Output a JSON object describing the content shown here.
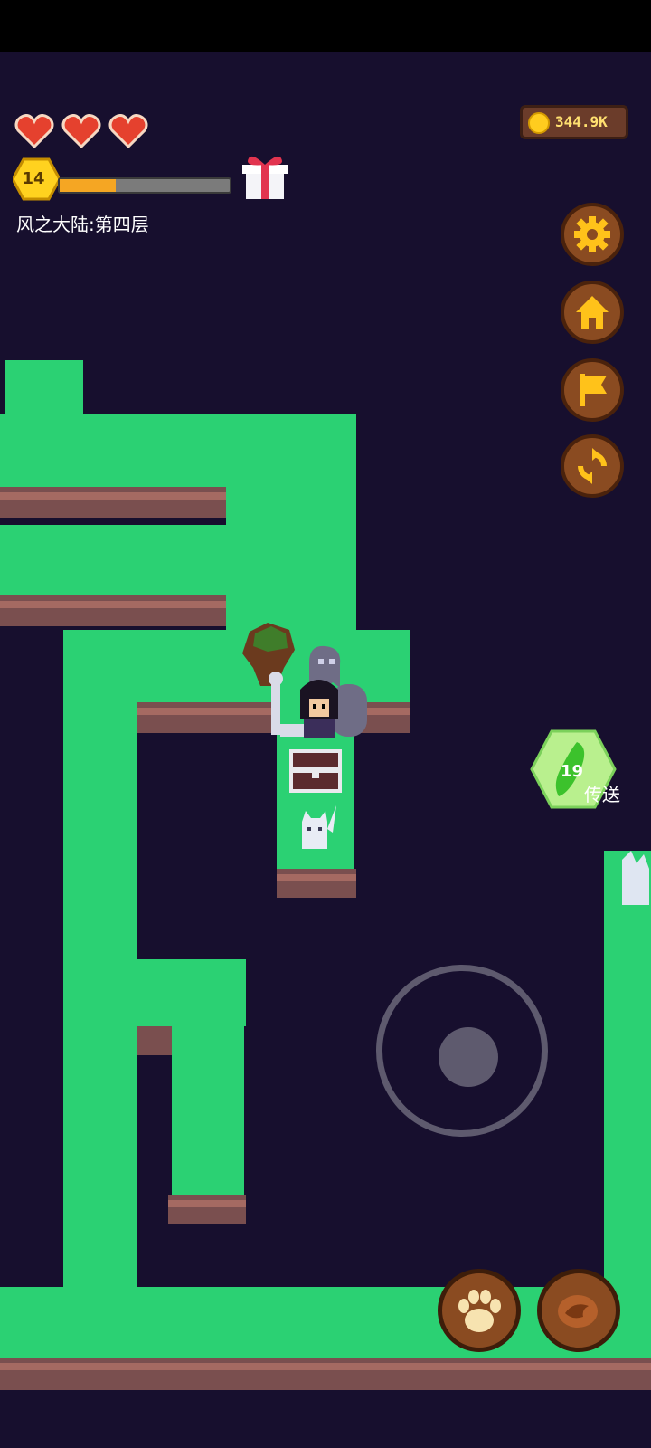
{
  "hud": {
    "hearts": 3,
    "level": "14",
    "xp_progress": 0.33,
    "coins": "344.9K",
    "floor_name": "风之大陆:第四层"
  },
  "side_buttons": [
    "gear-icon",
    "home-icon",
    "flag-icon",
    "refresh-icon"
  ],
  "teleport": {
    "count": "19",
    "label": "传送"
  },
  "action_buttons": [
    "paw-icon",
    "meat-icon"
  ],
  "colors": {
    "background": "#170f2e",
    "grass": "#2bd173",
    "dirt": "#7a4f4f",
    "button": "#8a4b21",
    "coin": "#ffcc1f"
  }
}
